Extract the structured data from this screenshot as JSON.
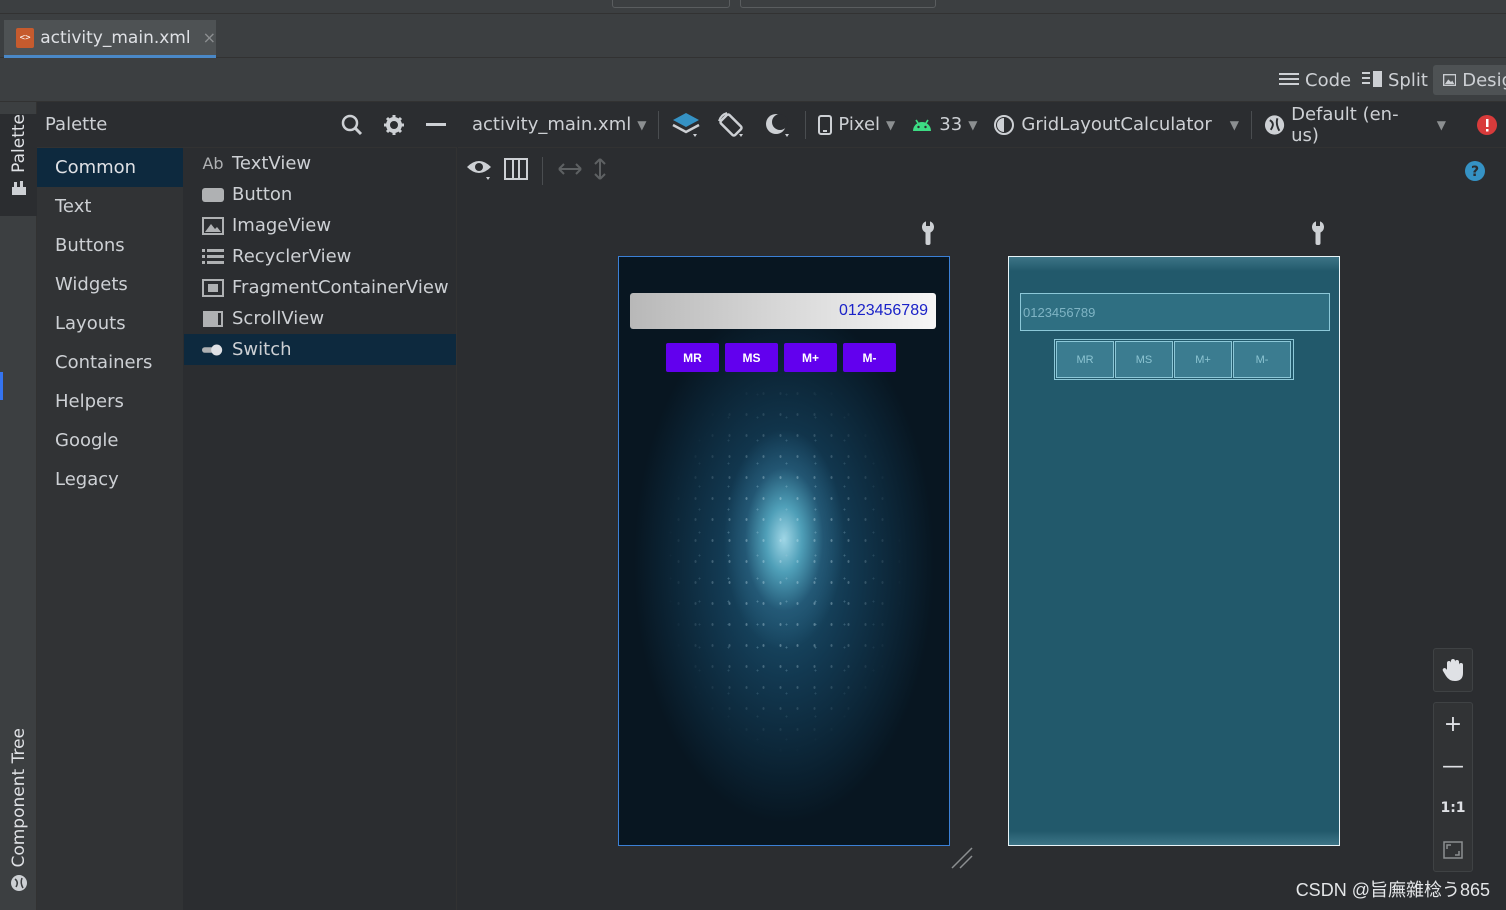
{
  "editor_tab": {
    "label": "activity_main.xml",
    "close": "×"
  },
  "view_modes": [
    {
      "label": "Code",
      "icon": "lines-icon"
    },
    {
      "label": "Split",
      "icon": "split-icon"
    },
    {
      "label": "Desig",
      "icon": "image-icon"
    }
  ],
  "side_tabs": {
    "palette": "Palette",
    "component_tree": "Component Tree"
  },
  "palette": {
    "title": "Palette",
    "categories": [
      "Common",
      "Text",
      "Buttons",
      "Widgets",
      "Layouts",
      "Containers",
      "Helpers",
      "Google",
      "Legacy"
    ],
    "selected_category": "Common",
    "items": [
      {
        "label": "TextView",
        "icon": "textview-icon",
        "glyph": "Ab"
      },
      {
        "label": "Button",
        "icon": "button-icon"
      },
      {
        "label": "ImageView",
        "icon": "imageview-icon"
      },
      {
        "label": "RecyclerView",
        "icon": "list-icon"
      },
      {
        "label": "FragmentContainerView",
        "icon": "fragment-icon"
      },
      {
        "label": "ScrollView",
        "icon": "scrollview-icon"
      },
      {
        "label": "Switch",
        "icon": "switch-icon"
      }
    ],
    "selected_item": "Switch"
  },
  "design_toolbar": {
    "file": "activity_main.xml",
    "device": "Pixel",
    "api": "33",
    "theme": "GridLayoutCalculator",
    "locale": "Default (en-us)"
  },
  "app_preview": {
    "display_text": "0123456789",
    "buttons": [
      "MR",
      "MS",
      "M+",
      "M-"
    ]
  },
  "zoom_controls": {
    "one_to_one": "1:1"
  },
  "watermark": "CSDN @旨廡雜棯う865",
  "colors": {
    "accent": "#4a88c7",
    "button_purple": "#6200ee",
    "blueprint": "#22596b",
    "selection": "#0d293e",
    "error": "#d83b3b",
    "help": "#3592c4"
  }
}
